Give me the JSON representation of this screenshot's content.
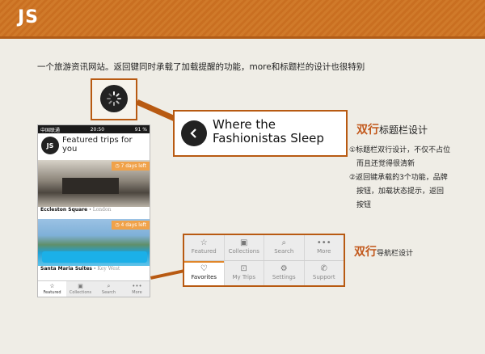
{
  "header": {
    "title": "JS"
  },
  "description": "一个旅游资讯网站。返回键同时承载了加载提醒的功能，more和标题栏的设计也很特别",
  "phone": {
    "status": {
      "carrier": "中国联通",
      "time": "20:50",
      "battery": "91 %"
    },
    "logo": "JS",
    "title": "Featured trips for you",
    "cards": [
      {
        "tag": "7 days left",
        "name": "Eccleston Square",
        "location": "London"
      },
      {
        "tag": "4 days left",
        "name": "Santa Maria Suites",
        "location": "Key West"
      }
    ],
    "tabs": [
      {
        "label": "Featured",
        "icon": "star-icon"
      },
      {
        "label": "Collections",
        "icon": "collections-icon"
      },
      {
        "label": "Search",
        "icon": "search-icon"
      },
      {
        "label": "More",
        "icon": "more-icon"
      }
    ]
  },
  "callout_title": {
    "text": "Where the Fashionistas Sleep"
  },
  "section1": {
    "strong": "双行",
    "rest": "标题栏设计",
    "notes": [
      "①标题栏双行设计，不仅不占位",
      "而且还觉得很清新",
      "②返回键承载的3个功能，品牌",
      "按钮，加载状态提示，返回",
      "按钮"
    ]
  },
  "nav": {
    "row1": [
      "Featured",
      "Collections",
      "Search",
      "More"
    ],
    "row2": [
      "Favorites",
      "My Trips",
      "Settings",
      "Support"
    ]
  },
  "section2": {
    "strong": "双行",
    "rest": "导航栏设计"
  },
  "colors": {
    "accent": "#b85a12",
    "header": "#d07a2a",
    "tag": "#f0a24a"
  }
}
